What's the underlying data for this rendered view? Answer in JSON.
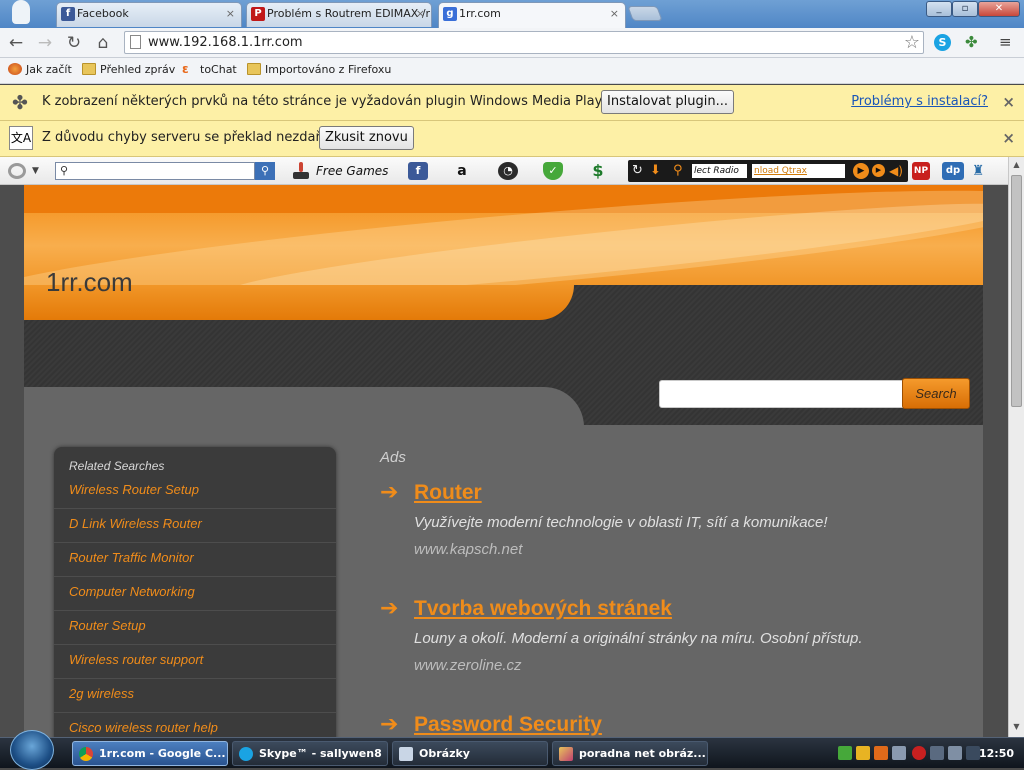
{
  "browser": {
    "tabs": [
      {
        "title": "Facebook",
        "favicon": "facebook-icon",
        "active": false
      },
      {
        "title": "Problém s Routrem EDIMAX /r",
        "favicon": "poradna-net-icon",
        "active": false
      },
      {
        "title": "1rr.com",
        "favicon": "google-icon",
        "active": true
      }
    ],
    "tab_close": "×",
    "window_controls": {
      "minimize": "_",
      "maximize": "▫",
      "close": "✕"
    },
    "url": "www.192.168.1.1rr.com",
    "bookmarks": [
      {
        "label": "Jak začít",
        "icon": "firefox-icon"
      },
      {
        "label": "Přehled zpráv",
        "icon": "folder-icon"
      },
      {
        "label": "toChat",
        "icon": "tochat-icon"
      },
      {
        "label": "Importováno z Firefoxu",
        "icon": "folder-icon"
      }
    ]
  },
  "infobars": {
    "plugin": {
      "message": "K zobrazení některých prvků na této stránce je vyžadován plugin Windows Media Player.",
      "install_button": "Instalovat plugin...",
      "help_link": "Problémy s instalací?",
      "close": "×"
    },
    "translate": {
      "message": "Z důvodu chyby serveru se překlad nezdařil.",
      "retry_button": "Zkusit znovu",
      "close": "×"
    }
  },
  "ext_toolbar": {
    "free_games": "Free Games",
    "radio_select": "lect Radio",
    "radio_download": "nload Qtrax"
  },
  "site": {
    "title": "1rr.com",
    "search_button": "Search",
    "related_title": "Related Searches",
    "related": [
      "Wireless Router Setup",
      "D Link Wireless Router",
      "Router Traffic Monitor",
      "Computer Networking",
      "Router Setup",
      "Wireless router support",
      "2g wireless",
      "Cisco wireless router help"
    ],
    "ads_label": "Ads",
    "arrow": "➔",
    "ads": [
      {
        "title": "Router",
        "desc": "Využívejte moderní technologie v oblasti IT, sítí a komunikace!",
        "url": "www.kapsch.net"
      },
      {
        "title": "Tvorba webových stránek",
        "desc": "Louny a okolí. Moderní a originální stránky na míru. Osobní přístup.",
        "url": "www.zeroline.cz"
      },
      {
        "title": "Password Security",
        "desc": "",
        "url": ""
      }
    ]
  },
  "taskbar": {
    "tasks": [
      {
        "label": "1rr.com - Google C...",
        "active": true
      },
      {
        "label": "Skype™ - sallywen8",
        "active": false
      },
      {
        "label": "Obrázky",
        "active": false
      },
      {
        "label": "poradna net obráz...",
        "active": false
      }
    ],
    "clock": "12:50"
  }
}
